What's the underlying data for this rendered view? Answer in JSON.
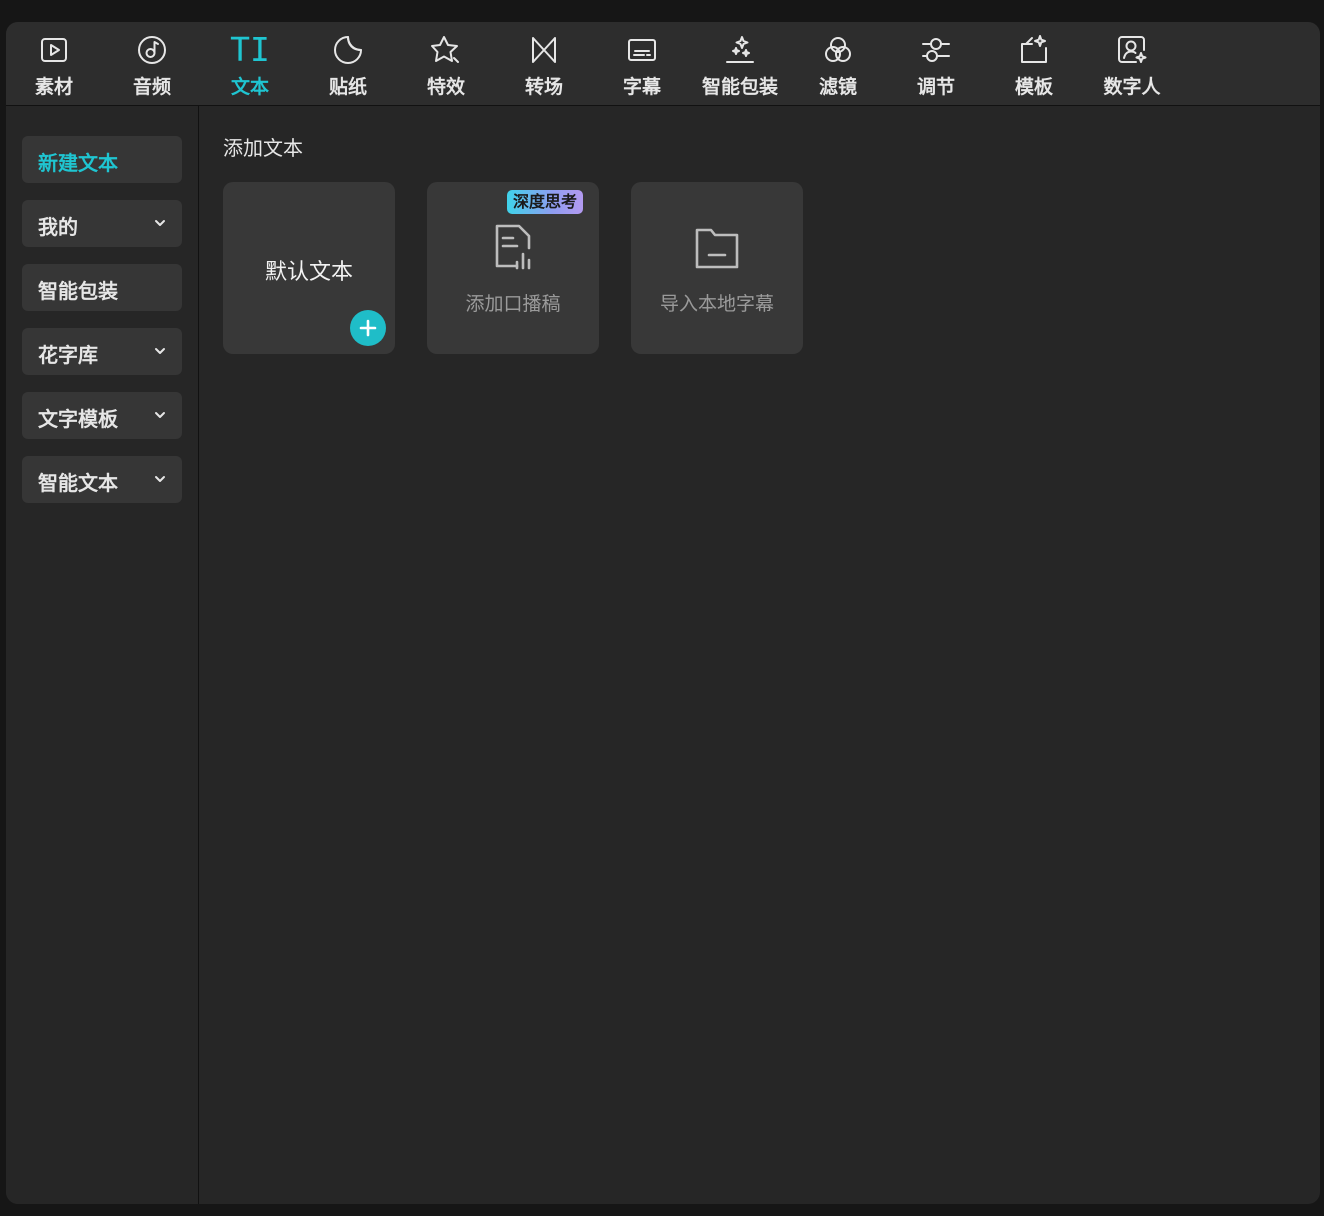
{
  "toolbar": {
    "items": [
      {
        "label": "素材",
        "icon": "media-play-icon"
      },
      {
        "label": "音频",
        "icon": "music-note-icon"
      },
      {
        "label": "文本",
        "icon": "text-ti-icon",
        "glyph": "TI",
        "active": true
      },
      {
        "label": "贴纸",
        "icon": "sticker-icon"
      },
      {
        "label": "特效",
        "icon": "effects-star-icon"
      },
      {
        "label": "转场",
        "icon": "transition-icon"
      },
      {
        "label": "字幕",
        "icon": "subtitle-icon"
      },
      {
        "label": "智能包装",
        "icon": "smart-package-sparkle-icon"
      },
      {
        "label": "滤镜",
        "icon": "filter-icon"
      },
      {
        "label": "调节",
        "icon": "adjust-sliders-icon"
      },
      {
        "label": "模板",
        "icon": "template-icon"
      },
      {
        "label": "数字人",
        "icon": "digital-human-icon"
      }
    ],
    "accent_color": "#1fc5d1"
  },
  "sidebar": {
    "items": [
      {
        "label": "新建文本",
        "active": true,
        "expandable": false
      },
      {
        "label": "我的",
        "active": false,
        "expandable": true
      },
      {
        "label": "智能包装",
        "active": false,
        "expandable": false
      },
      {
        "label": "花字库",
        "active": false,
        "expandable": true
      },
      {
        "label": "文字模板",
        "active": false,
        "expandable": true
      },
      {
        "label": "智能文本",
        "active": false,
        "expandable": true
      }
    ]
  },
  "content": {
    "section_title": "添加文本",
    "cards": [
      {
        "label": "默认文本",
        "has_add_button": true
      },
      {
        "label": "添加口播稿",
        "icon": "script-document-mic-icon",
        "badge": "深度思考"
      },
      {
        "label": "导入本地字幕",
        "icon": "folder-icon"
      }
    ]
  }
}
